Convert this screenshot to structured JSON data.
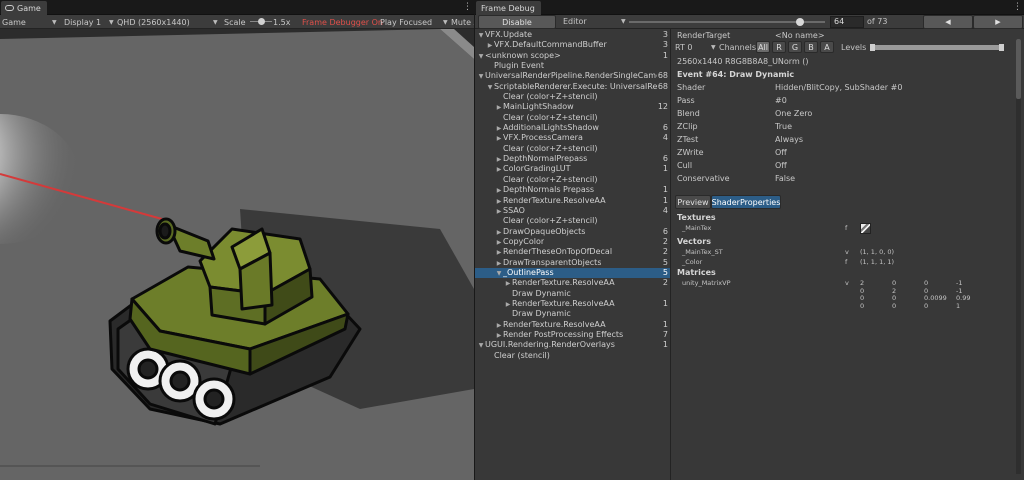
{
  "game": {
    "tab": "Game",
    "view_dropdown": "Game",
    "display": "Display 1",
    "resolution": "QHD (2560x1440)",
    "scale_label": "Scale",
    "scale_value": "1.5x",
    "frame_debugger_on": "Frame Debugger On",
    "play_focused": "Play Focused",
    "mute": "Mute A"
  },
  "frame_debug": {
    "tab": "Frame Debug",
    "disable_label": "Disable",
    "editor_label": "Editor",
    "event_index": "64",
    "event_total": "of 73",
    "slider_fraction": 0.87,
    "tree": [
      {
        "d": 0,
        "a": "down",
        "t": "VFX.Update",
        "c": "3"
      },
      {
        "d": 1,
        "a": "right",
        "t": "VFX.DefaultCommandBuffer",
        "c": "3"
      },
      {
        "d": 0,
        "a": "down",
        "t": "<unknown scope>",
        "c": "1"
      },
      {
        "d": 1,
        "a": "",
        "t": "Plugin Event",
        "c": ""
      },
      {
        "d": 0,
        "a": "down",
        "t": "UniversalRenderPipeline.RenderSingleCamera",
        "c": "68"
      },
      {
        "d": 1,
        "a": "down",
        "t": "ScriptableRenderer.Execute: UniversalRende",
        "c": "68"
      },
      {
        "d": 2,
        "a": "",
        "t": "Clear (color+Z+stencil)",
        "c": ""
      },
      {
        "d": 2,
        "a": "right",
        "t": "MainLightShadow",
        "c": "12"
      },
      {
        "d": 2,
        "a": "",
        "t": "Clear (color+Z+stencil)",
        "c": ""
      },
      {
        "d": 2,
        "a": "right",
        "t": "AdditionalLightsShadow",
        "c": "6"
      },
      {
        "d": 2,
        "a": "right",
        "t": "VFX.ProcessCamera",
        "c": "4"
      },
      {
        "d": 2,
        "a": "",
        "t": "Clear (color+Z+stencil)",
        "c": ""
      },
      {
        "d": 2,
        "a": "right",
        "t": "DepthNormalPrepass",
        "c": "6"
      },
      {
        "d": 2,
        "a": "right",
        "t": "ColorGradingLUT",
        "c": "1"
      },
      {
        "d": 2,
        "a": "",
        "t": "Clear (color+Z+stencil)",
        "c": ""
      },
      {
        "d": 2,
        "a": "right",
        "t": "DepthNormals Prepass",
        "c": "1"
      },
      {
        "d": 2,
        "a": "right",
        "t": "RenderTexture.ResolveAA",
        "c": "1"
      },
      {
        "d": 2,
        "a": "right",
        "t": "SSAO",
        "c": "4"
      },
      {
        "d": 2,
        "a": "",
        "t": "Clear (color+Z+stencil)",
        "c": ""
      },
      {
        "d": 2,
        "a": "right",
        "t": "DrawOpaqueObjects",
        "c": "6"
      },
      {
        "d": 2,
        "a": "right",
        "t": "CopyColor",
        "c": "2"
      },
      {
        "d": 2,
        "a": "right",
        "t": "RenderTheseOnTopOfDecal",
        "c": "2"
      },
      {
        "d": 2,
        "a": "right",
        "t": "DrawTransparentObjects",
        "c": "5"
      },
      {
        "d": 2,
        "a": "down",
        "t": "_OutlinePass",
        "c": "5",
        "sel": true
      },
      {
        "d": 3,
        "a": "right",
        "t": "RenderTexture.ResolveAA",
        "c": "2"
      },
      {
        "d": 3,
        "a": "",
        "t": "Draw Dynamic",
        "c": ""
      },
      {
        "d": 3,
        "a": "right",
        "t": "RenderTexture.ResolveAA",
        "c": "1"
      },
      {
        "d": 3,
        "a": "",
        "t": "Draw Dynamic",
        "c": ""
      },
      {
        "d": 2,
        "a": "right",
        "t": "RenderTexture.ResolveAA",
        "c": "1"
      },
      {
        "d": 2,
        "a": "right",
        "t": "Render PostProcessing Effects",
        "c": "7"
      },
      {
        "d": 0,
        "a": "down",
        "t": "UGUI.Rendering.RenderOverlays",
        "c": "1"
      },
      {
        "d": 1,
        "a": "",
        "t": "Clear (stencil)",
        "c": ""
      }
    ],
    "detail": {
      "render_target_label": "RenderTarget",
      "render_target_value": "<No name>",
      "rt_dropdown": "RT 0",
      "channels_label": "Channels",
      "channels": [
        "All",
        "R",
        "G",
        "B",
        "A"
      ],
      "levels_label": "Levels",
      "format": "2560x1440 R8G8B8A8_UNorm ()",
      "event_title": "Event #64: Draw Dynamic",
      "props": [
        {
          "k": "Shader",
          "v": "Hidden/BlitCopy, SubShader #0"
        },
        {
          "k": "Pass",
          "v": "#0"
        },
        {
          "k": "Blend",
          "v": "One Zero"
        },
        {
          "k": "ZClip",
          "v": "True"
        },
        {
          "k": "ZTest",
          "v": "Always"
        },
        {
          "k": "ZWrite",
          "v": "Off"
        },
        {
          "k": "Cull",
          "v": "Off"
        },
        {
          "k": "Conservative",
          "v": "False"
        }
      ],
      "tab_preview": "Preview",
      "tab_shader_props": "ShaderProperties",
      "textures_header": "Textures",
      "maintex_name": "_MainTex",
      "maintex_stage": "f",
      "vectors_header": "Vectors",
      "vectors": [
        {
          "name": "_MainTex_ST",
          "stage": "v",
          "value": "(1, 1, 0, 0)"
        },
        {
          "name": "_Color",
          "stage": "f",
          "value": "(1, 1, 1, 1)"
        }
      ],
      "matrices_header": "Matrices",
      "matrix_name": "unity_MatrixVP",
      "matrix_stage": "v",
      "matrix": [
        [
          "2",
          "0",
          "0",
          "-1"
        ],
        [
          "0",
          "2",
          "0",
          "-1"
        ],
        [
          "0",
          "0",
          "0.0099",
          "0.99"
        ],
        [
          "0",
          "0",
          "0",
          "1"
        ]
      ]
    }
  },
  "colors": {
    "selection": "#2c5d87",
    "frame_debugger_on": "#e0504a",
    "tank_green": "#6d7e2a",
    "laser": "#d43a3a"
  }
}
